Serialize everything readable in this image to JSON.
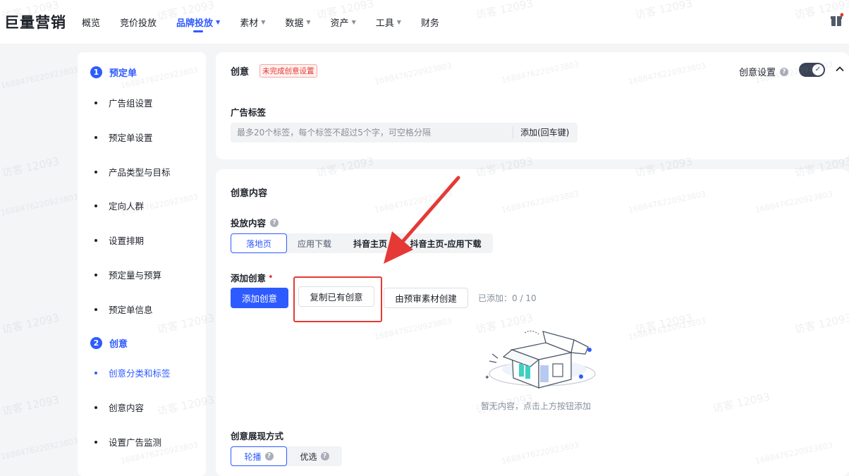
{
  "app": {
    "logo": "巨量营销"
  },
  "nav": {
    "items": [
      {
        "label": "概览",
        "caret": false,
        "active": false
      },
      {
        "label": "竞价投放",
        "caret": false,
        "active": false
      },
      {
        "label": "品牌投放",
        "caret": true,
        "active": true
      },
      {
        "label": "素材",
        "caret": true,
        "active": false
      },
      {
        "label": "数据",
        "caret": true,
        "active": false
      },
      {
        "label": "资产",
        "caret": true,
        "active": false
      },
      {
        "label": "工具",
        "caret": true,
        "active": false
      },
      {
        "label": "财务",
        "caret": false,
        "active": false
      }
    ],
    "caret_glyph": "▼"
  },
  "steps": {
    "step1": {
      "num": "1",
      "title": "预定单"
    },
    "step1_items": [
      "广告组设置",
      "预定单设置",
      "产品类型与目标",
      "定向人群",
      "设置排期",
      "预定量与预算",
      "预定单信息"
    ],
    "step2": {
      "num": "2",
      "title": "创意"
    },
    "step2_items": [
      "创意分类和标签",
      "创意内容",
      "设置广告监测"
    ]
  },
  "creative_header": {
    "title": "创意",
    "warning_tag": "未完成创意设置",
    "setting_label": "创意设置",
    "toggle_on": true
  },
  "ad_tags": {
    "label": "广告标签",
    "placeholder": "最多20个标签，每个标签不超过5个字，可空格分隔",
    "add_label": "添加(回车键)"
  },
  "creative_content": {
    "title": "创意内容",
    "delivery_label": "投放内容",
    "delivery_options": [
      "落地页",
      "应用下载",
      "抖音主页",
      "抖音主页-应用下载"
    ],
    "delivery_selected": "落地页",
    "add_label": "添加创意",
    "required_mark": "•",
    "add_button": "添加创意",
    "copy_button": "复制已有创意",
    "prereview_button": "由预审素材创建",
    "added_count": "已添加：0 / 10",
    "empty_text": "暂无内容，点击上方按钮添加",
    "display_label": "创意展现方式",
    "display_options": [
      "轮播",
      "优选"
    ],
    "display_selected": "轮播"
  },
  "icons": {
    "help": "?",
    "check": "✓"
  },
  "watermark": {
    "name": "访客 12093",
    "id": "16884762209238​03"
  },
  "colors": {
    "accent": "#2e5bff",
    "annotation": "#e53935",
    "warning": "#e5372c"
  }
}
